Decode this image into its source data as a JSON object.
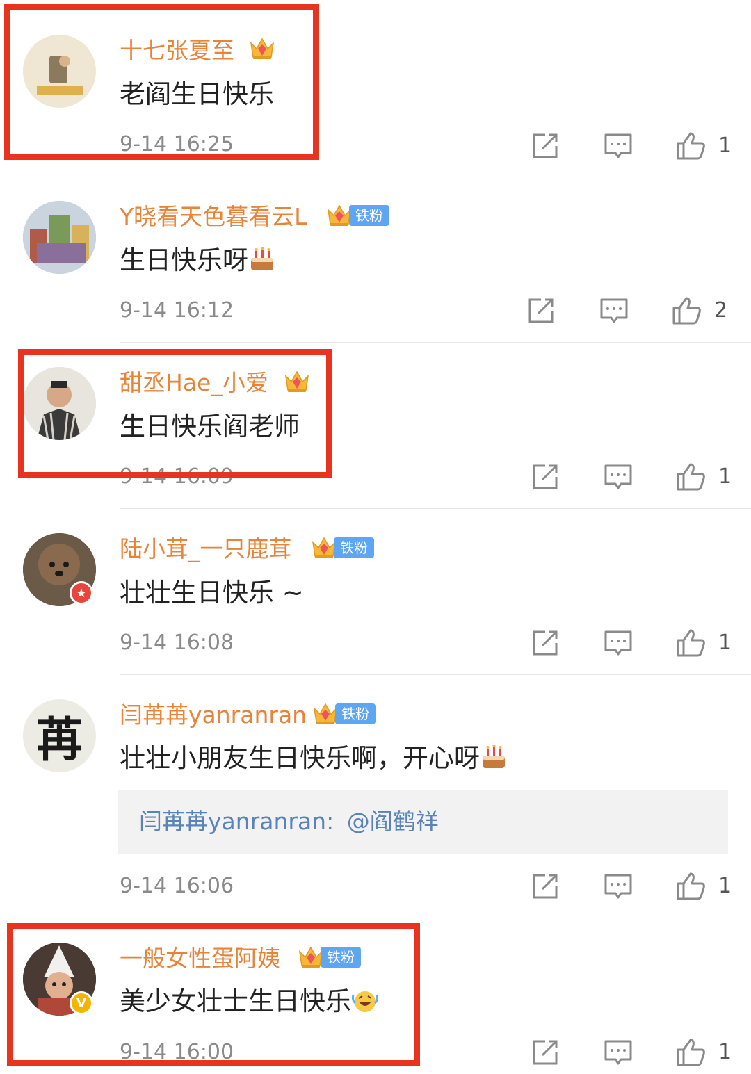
{
  "comments": [
    {
      "name": "十七张夏至",
      "text": "老阎生日快乐",
      "emoji": "",
      "time": "9-14 16:25",
      "likes": "1",
      "fan_badge": "",
      "level": "5"
    },
    {
      "name": "Y晓看天色暮看云L",
      "text": "生日快乐呀",
      "emoji": "cake",
      "time": "9-14 16:12",
      "likes": "2",
      "fan_badge": "铁粉",
      "level": "5"
    },
    {
      "name": "甜丞Hae_小爱",
      "text": "生日快乐阎老师",
      "emoji": "",
      "time": "9-14 16:09",
      "likes": "1",
      "fan_badge": "",
      "level": "5"
    },
    {
      "name": "陆小茸_一只鹿茸",
      "text": "壮壮生日快乐 ~",
      "emoji": "",
      "time": "9-14 16:08",
      "likes": "1",
      "fan_badge": "铁粉",
      "level": "6"
    },
    {
      "name": "闫苒苒yanranran",
      "text": "壮壮小朋友生日快乐啊，开心呀",
      "emoji": "cake",
      "time": "9-14 16:06",
      "likes": "1",
      "fan_badge": "铁粉",
      "level": "7",
      "reply": {
        "author": "闫苒苒yanranran:",
        "mention": "@阎鹤祥"
      },
      "avatar_char": "苒"
    },
    {
      "name": "一般女性蛋阿姨",
      "text": "美少女壮士生日快乐",
      "emoji": "laugh-cry",
      "time": "9-14 16:00",
      "likes": "1",
      "fan_badge": "铁粉",
      "level": "7",
      "verified": "V"
    }
  ],
  "icons": {
    "share": "share-icon",
    "comment": "comment-icon",
    "like": "like-icon"
  },
  "colors": {
    "username": "#e8843a",
    "highlight_border": "#e8341f",
    "fan_badge": "#5ea6f2",
    "reply_link": "#5a83b8"
  }
}
